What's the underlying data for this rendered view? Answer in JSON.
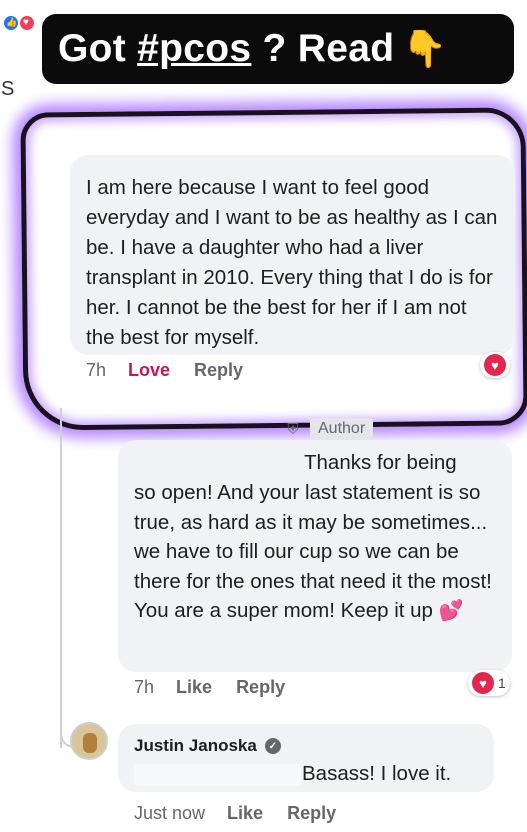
{
  "banner": {
    "text_prefix": "Got ",
    "hashtag": "#pcos",
    "text_suffix": " ? Read",
    "icon": "pointing-down-hand-icon"
  },
  "cut_off_letter": "S",
  "comments": [
    {
      "text": "I am here because I want to feel good everyday and I want to be as healthy as I can be. I have a daughter who had a liver transplant in 2010. Every thing that I do is for her. I cannot be the best for her if I am not the best for myself.",
      "time": "7h",
      "love_label": "Love",
      "reply_label": "Reply",
      "reaction_icon": "heart-icon"
    },
    {
      "author_tag": "Author",
      "line1": "Thanks for being",
      "body": "so open! And your last statement is so true, as hard as it may be sometimes... we have to fill our cup so we can be there for the ones that need it the most! You are a super mom! Keep it up",
      "emoji": "💕",
      "time": "7h",
      "like_label": "Like",
      "reply_label": "Reply",
      "reaction_count": "1"
    },
    {
      "name": "Justin Janoska",
      "text": "Basass! I love it.",
      "time": "Just now",
      "like_label": "Like",
      "reply_label": "Reply"
    }
  ],
  "colors": {
    "banner_bg": "#0b0b0b",
    "highlight_glow": "#b587ff",
    "love_text": "#c2185b",
    "bubble_bg": "#f0f2f5"
  }
}
